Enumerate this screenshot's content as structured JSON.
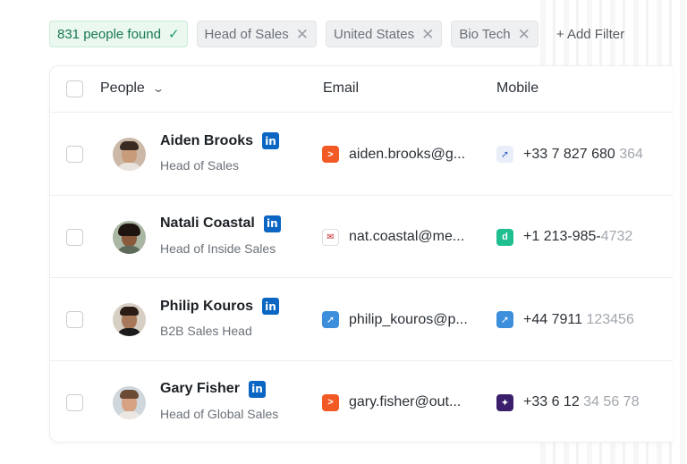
{
  "filters": {
    "found": "831 people found",
    "chips": [
      "Head of Sales",
      "United States",
      "Bio Tech"
    ],
    "add_filter": "+ Add Filter"
  },
  "table": {
    "columns": {
      "people": "People",
      "email": "Email",
      "mobile": "Mobile"
    },
    "rows": [
      {
        "name": "Aiden Brooks",
        "title": "Head of Sales",
        "email": "aiden.brooks@g...",
        "email_source_icon": "orange-source-icon",
        "mobile_main": "+33 7 827 680",
        "mobile_fade": " 364",
        "mobile_source_icon": "rocket-source-icon"
      },
      {
        "name": "Natali Coastal",
        "title": "Head of Inside Sales",
        "email": "nat.coastal@me...",
        "email_source_icon": "mail-source-icon",
        "mobile_main": "+1 213-985-",
        "mobile_fade": "4732",
        "mobile_source_icon": "teal-d-source-icon"
      },
      {
        "name": "Philip Kouros",
        "title": "B2B Sales Head",
        "email": "philip_kouros@p...",
        "email_source_icon": "blue-rocket-source-icon",
        "mobile_main": "+44 7911",
        "mobile_fade": " 123456",
        "mobile_source_icon": "blue-rocket-source-icon"
      },
      {
        "name": "Gary Fisher",
        "title": "Head of Global Sales",
        "email": "gary.fisher@out...",
        "email_source_icon": "orange-source-icon",
        "mobile_main": "+33 6 12",
        "mobile_fade": " 34 56 78",
        "mobile_source_icon": "purple-source-icon"
      }
    ]
  },
  "colors": {
    "found_green": "#18794e",
    "linkedin_blue": "#0a66c2",
    "chip_bg": "#eef0f2"
  }
}
